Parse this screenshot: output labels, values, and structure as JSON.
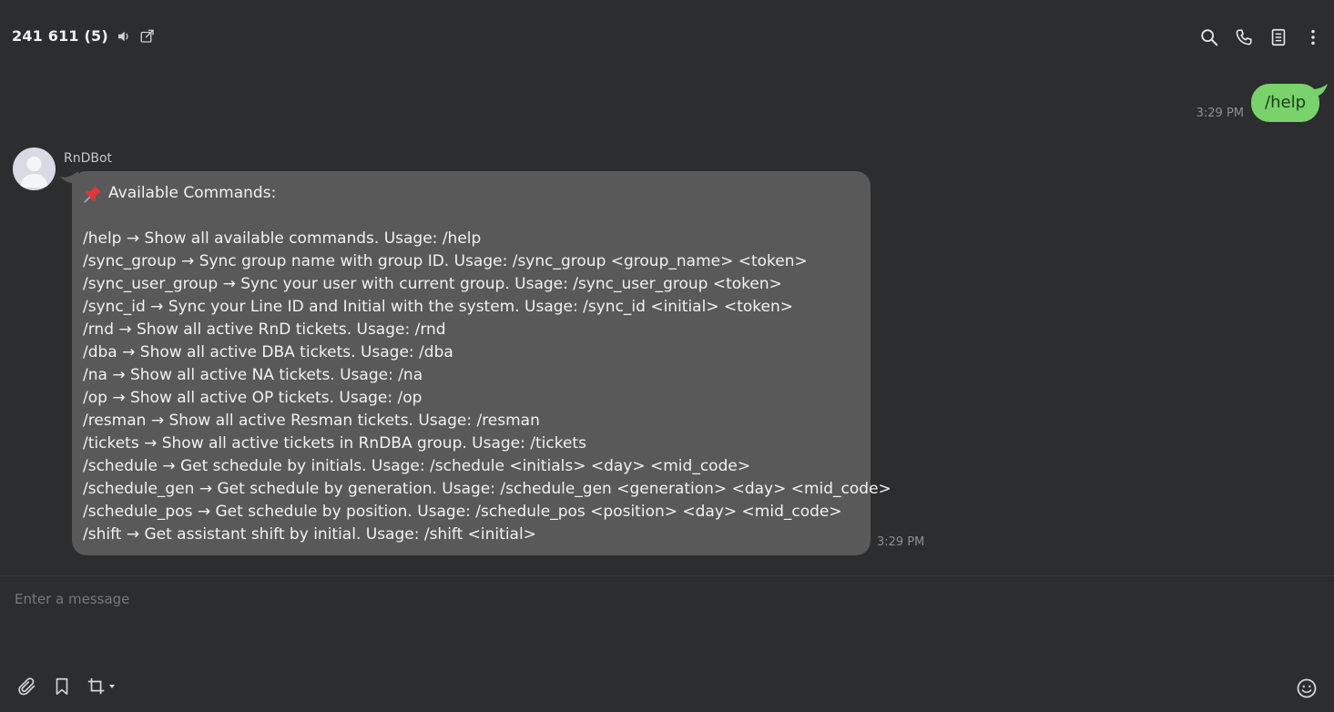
{
  "header": {
    "title": "241 611 (5)",
    "icons": [
      "speaker-icon",
      "external-window-icon",
      "search-icon",
      "phone-icon",
      "notes-icon",
      "more-vertical-icon"
    ]
  },
  "messages": {
    "outgoing": {
      "text": "/help",
      "time": "3:29 PM"
    },
    "incoming": {
      "sender": "RnDBot",
      "heading": "Available Commands:",
      "lines": [
        "/help → Show all available commands. Usage: /help",
        "/sync_group → Sync group name with group ID. Usage: /sync_group <group_name> <token>",
        "/sync_user_group → Sync your user with current group. Usage: /sync_user_group <token>",
        "/sync_id → Sync your Line ID and Initial with the system. Usage: /sync_id <initial> <token>",
        "/rnd → Show all active RnD tickets. Usage: /rnd",
        "/dba → Show all active DBA tickets. Usage: /dba",
        "/na → Show all active NA tickets. Usage: /na",
        "/op → Show all active OP tickets. Usage: /op",
        "/resman → Show all active Resman tickets. Usage: /resman",
        "/tickets → Show all active tickets in RnDBA group. Usage: /tickets",
        "/schedule → Get schedule by initials. Usage: /schedule <initials> <day> <mid_code>",
        "/schedule_gen → Get schedule by generation. Usage: /schedule_gen <generation> <day> <mid_code>",
        "/schedule_pos → Get schedule by position. Usage: /schedule_pos <position> <day> <mid_code>",
        "/shift → Get assistant shift by initial. Usage: /shift <initial>"
      ],
      "time": "3:29 PM"
    }
  },
  "composer": {
    "placeholder": "Enter a message",
    "value": ""
  },
  "colors": {
    "background": "#2c2d2f",
    "outgoing_bubble": "#79d26b",
    "incoming_bubble": "#595959"
  }
}
